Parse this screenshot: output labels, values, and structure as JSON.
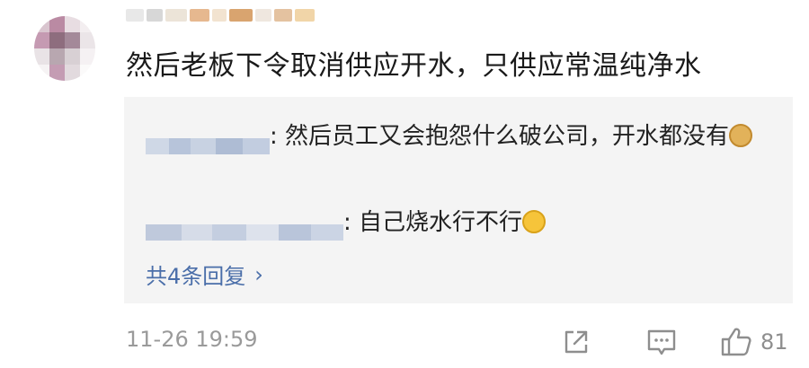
{
  "comment": {
    "author_blurred": true,
    "text": "然后老板下令取消供应开水，只供应常温纯净水"
  },
  "replies": [
    {
      "author_blurred": true,
      "text": ": 然后员工又会抱怨什么破公司，开水都没有",
      "emoji": "doge-emoji"
    },
    {
      "author_blurred": true,
      "text": ": 自己烧水行不行",
      "emoji": "grin-emoji"
    }
  ],
  "more_replies_label": "共4条回复",
  "footer": {
    "timestamp": "11-26 19:59",
    "like_count": "81"
  },
  "colors": {
    "reply_bg": "#f4f4f4",
    "link_blue": "#4a6ea9",
    "meta_gray": "#9a9a9a"
  }
}
